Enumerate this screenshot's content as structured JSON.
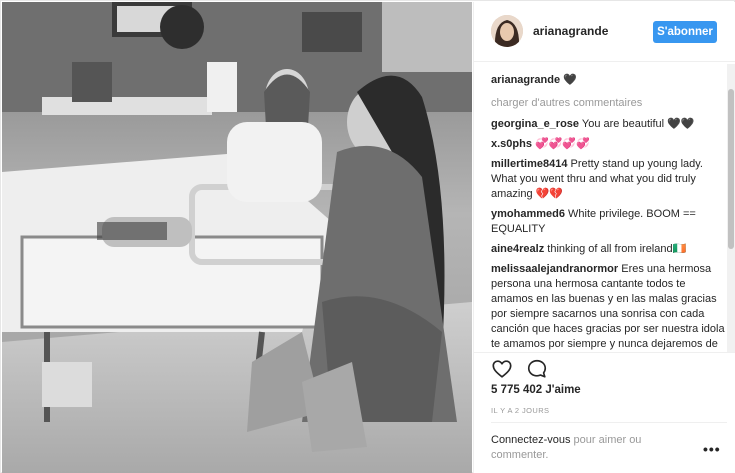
{
  "post": {
    "username": "arianagrande",
    "follow_label": "S'abonner",
    "caption_user": "arianagrande",
    "caption_text": "🖤",
    "load_more": "charger d'autres commentaires",
    "comments": [
      {
        "user": "georgina_e_rose",
        "text": "You are beautiful 🖤🖤"
      },
      {
        "user": "x.s0phs",
        "text": "💞💞💞💞"
      },
      {
        "user": "millertime8414",
        "text": "Pretty stand up young lady. What you went thru and what you did truly amazing 💔💔"
      },
      {
        "user": "ymohammed6",
        "text": "White privilege. BOOM == EQUALITY"
      },
      {
        "user": "aine4realz",
        "text": "thinking of all from ireland🇮🇪"
      },
      {
        "user": "melissaalejandranormor",
        "text": "Eres una hermosa persona una hermosa cantante todos te amamos en las buenas y en las malas gracias por siempre sacarnos una sonrisa con cada canción que haces gracias por ser nuestra idola te amamos por siempre y nunca dejaremos de amarte"
      }
    ],
    "likes": "5 775 402 J'aime",
    "time_ago": "IL Y A 2 JOURS",
    "login_link": "Connectez-vous",
    "login_text": " pour aimer ou commenter.",
    "more_label": "•••"
  },
  "icons": {
    "like": "heart-outline-icon",
    "comment": "speech-bubble-icon",
    "more": "more-options-icon"
  },
  "colors": {
    "accent": "#3897f0",
    "text": "#262626",
    "muted": "#999999",
    "border": "#efefef"
  }
}
